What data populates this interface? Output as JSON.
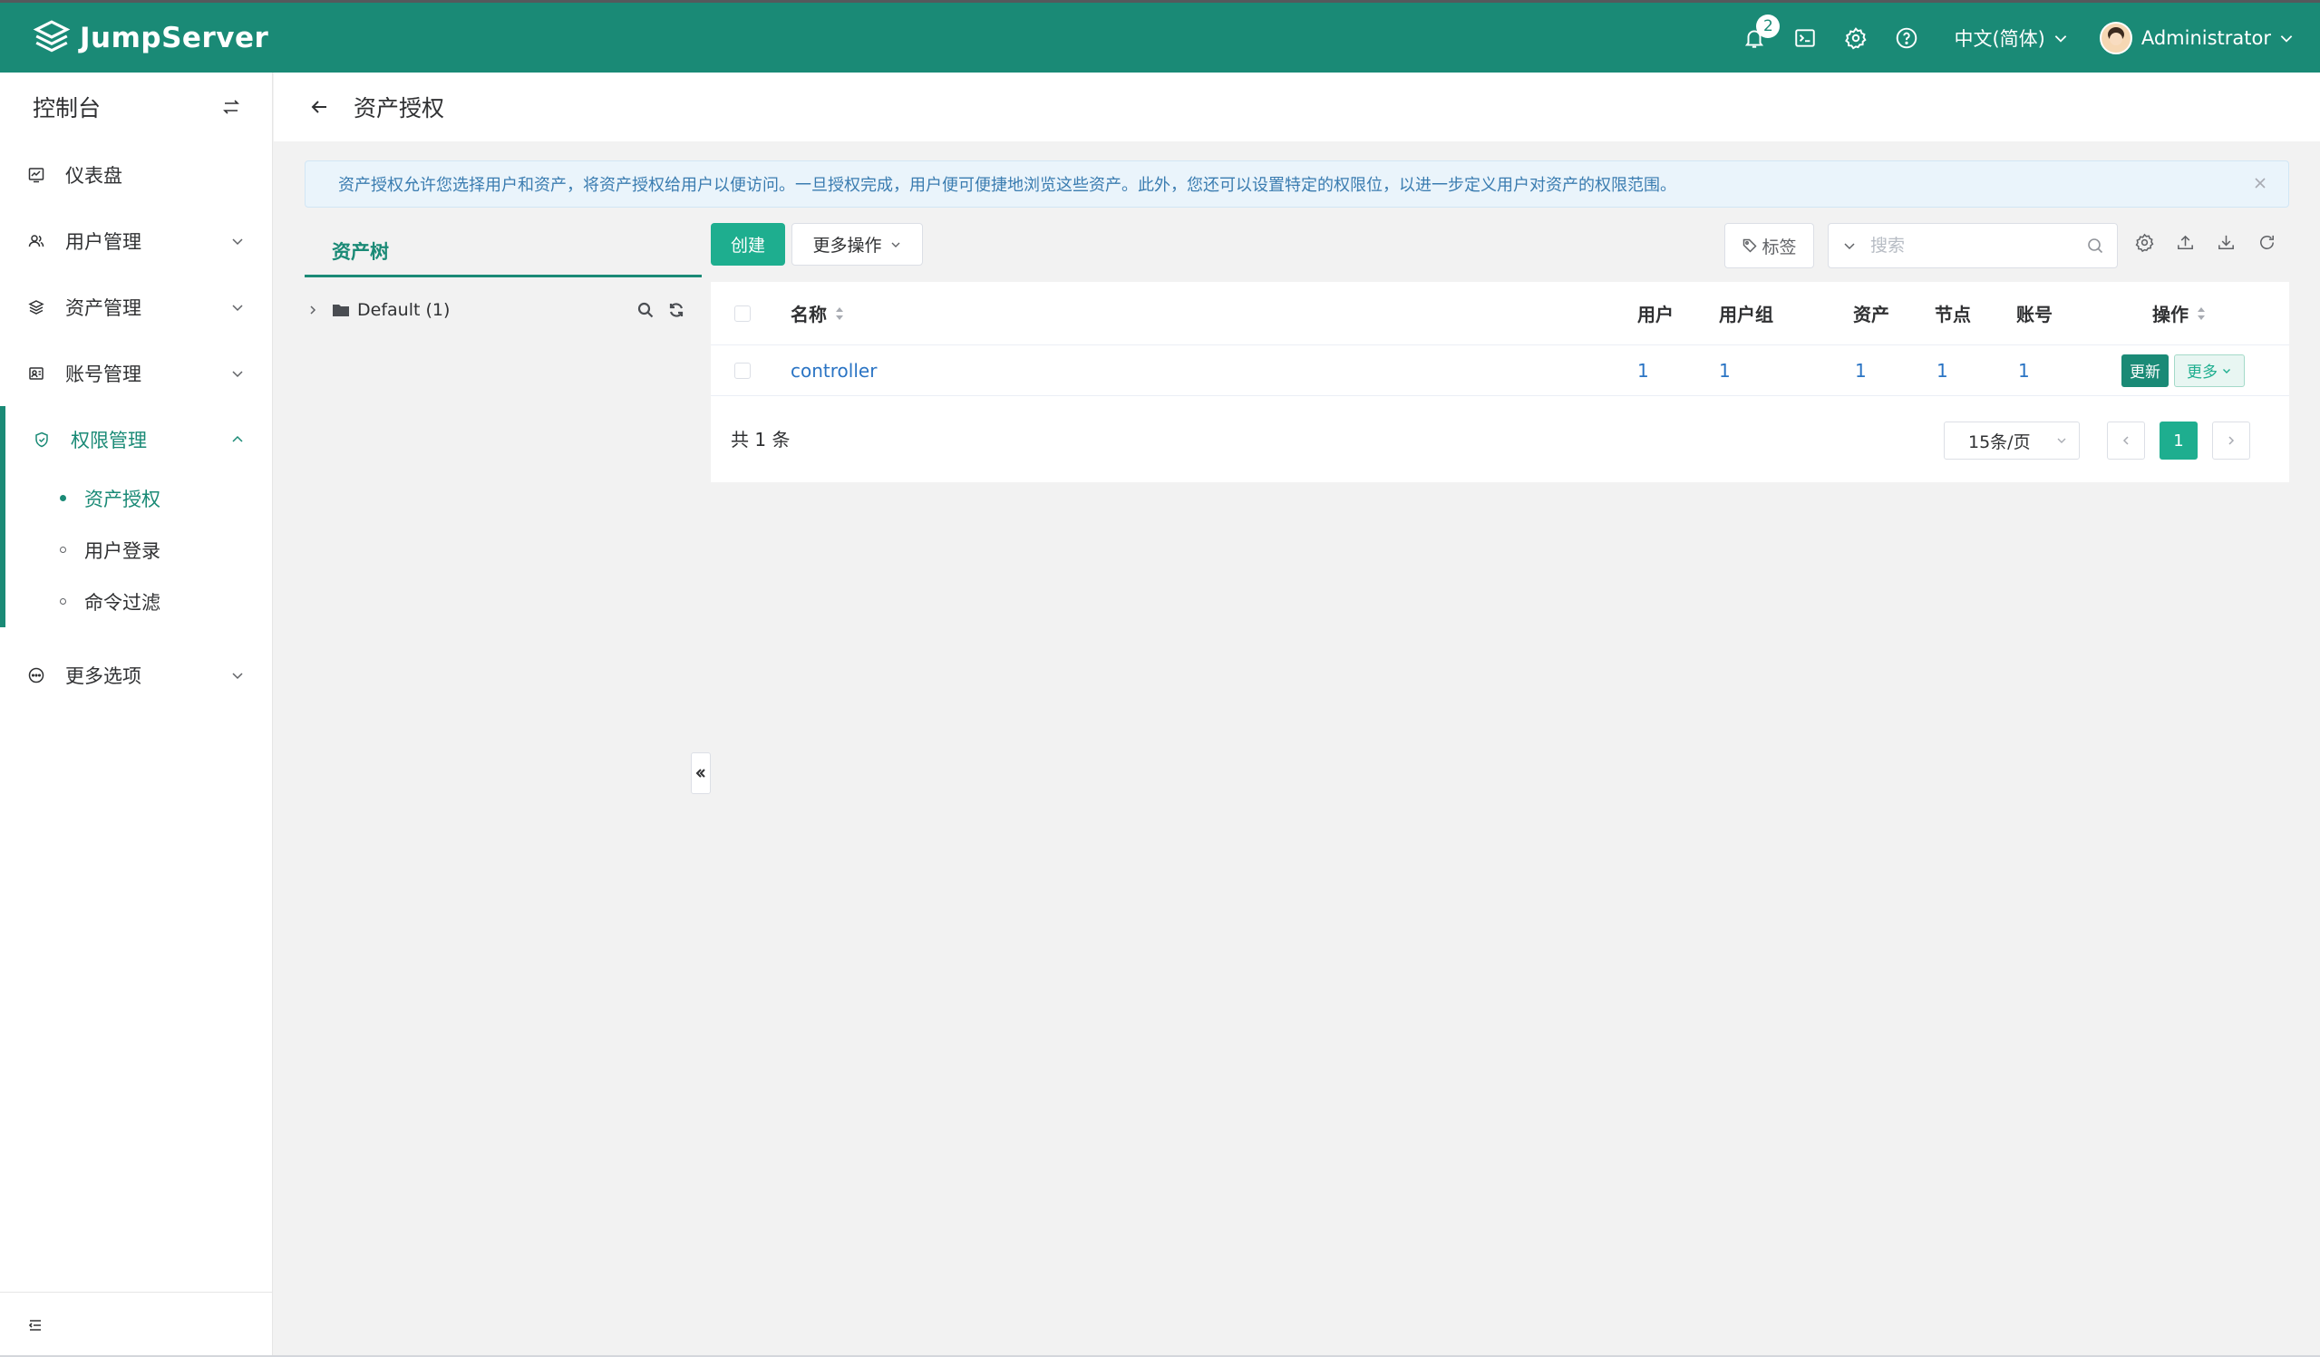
{
  "brand": {
    "name": "JumpServer"
  },
  "topbar": {
    "notifications_count": "2",
    "language": "中文(简体)",
    "username": "Administrator"
  },
  "sidebar": {
    "title": "控制台",
    "items": [
      {
        "label": "仪表盘",
        "icon": "dashboard-icon"
      },
      {
        "label": "用户管理",
        "icon": "users-icon"
      },
      {
        "label": "资产管理",
        "icon": "assets-icon"
      },
      {
        "label": "账号管理",
        "icon": "accounts-icon"
      },
      {
        "label": "权限管理",
        "icon": "shield-icon"
      },
      {
        "label": "更多选项",
        "icon": "more-options-icon"
      }
    ],
    "sub_items": [
      {
        "label": "资产授权"
      },
      {
        "label": "用户登录"
      },
      {
        "label": "命令过滤"
      }
    ]
  },
  "page": {
    "title": "资产授权",
    "alert": "资产授权允许您选择用户和资产，将资产授权给用户以便访问。一旦授权完成，用户便可便捷地浏览这些资产。此外，您还可以设置特定的权限位，以进一步定义用户对资产的权限范围。"
  },
  "tree": {
    "tab_label": "资产树",
    "node_label": "Default (1)"
  },
  "toolbar": {
    "create_label": "创建",
    "more_actions_label": "更多操作",
    "tag_label": "标签",
    "search_placeholder": "搜索"
  },
  "table": {
    "headers": {
      "name": "名称",
      "users": "用户",
      "user_groups": "用户组",
      "assets": "资产",
      "nodes": "节点",
      "accounts": "账号",
      "actions": "操作"
    },
    "rows": [
      {
        "name": "controller",
        "users": "1",
        "user_groups": "1",
        "assets": "1",
        "nodes": "1",
        "accounts": "1"
      }
    ],
    "update_label": "更新",
    "more_label": "更多"
  },
  "pagination": {
    "total": "共 1 条",
    "page_size": "15条/页",
    "current_page": "1"
  },
  "colors": {
    "primary": "#1a8a76",
    "accent": "#1eae8f",
    "link": "#2a74c4"
  }
}
